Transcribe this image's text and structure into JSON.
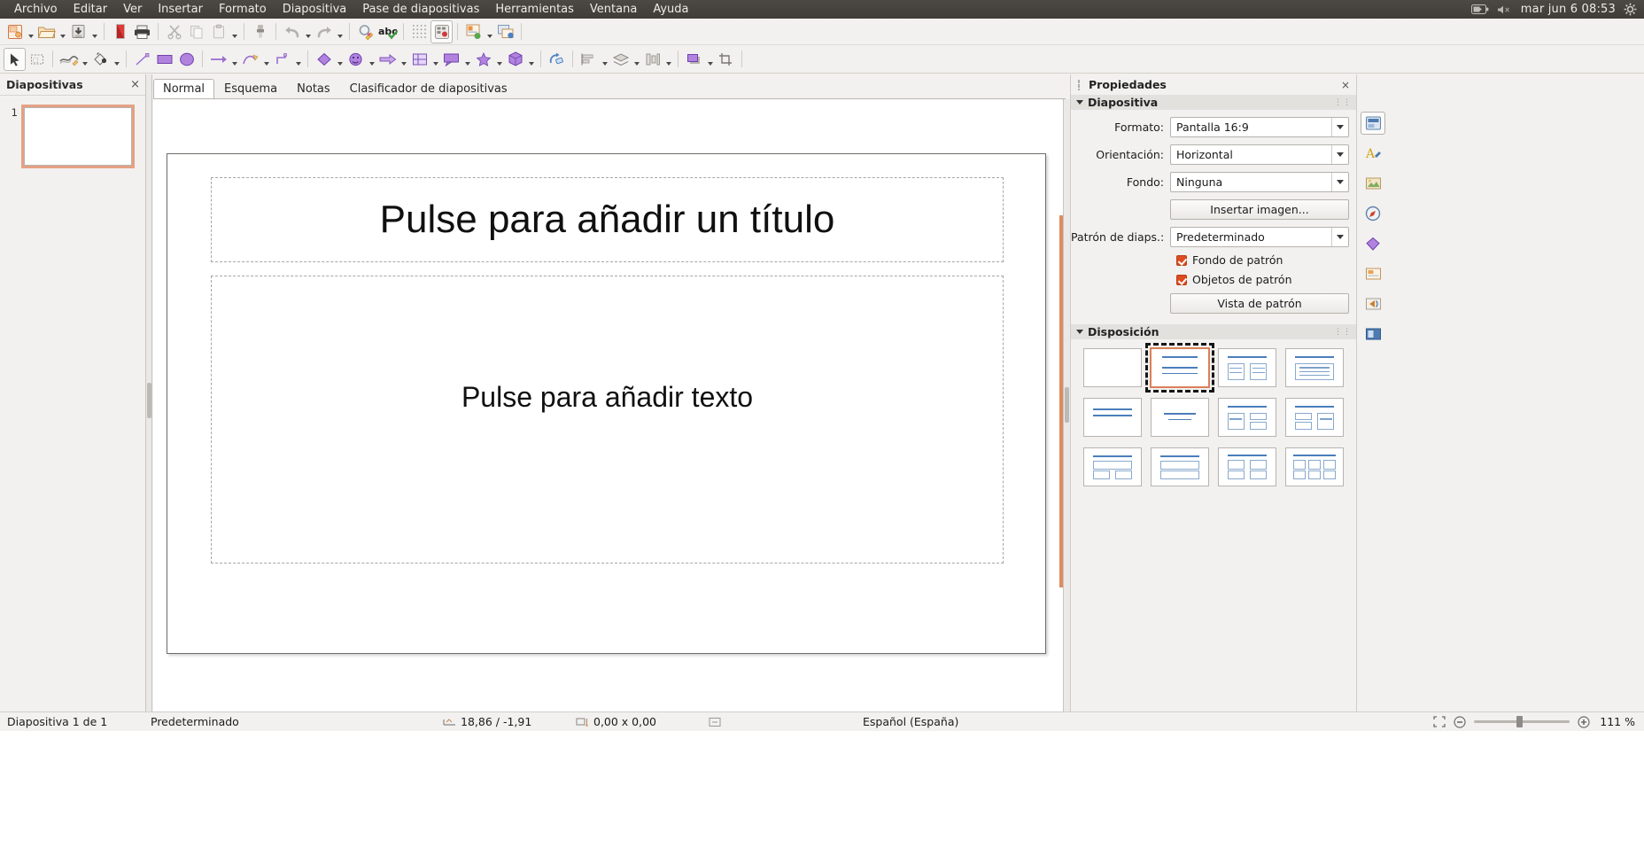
{
  "topbar": {
    "menu": [
      "Archivo",
      "Editar",
      "Ver",
      "Insertar",
      "Formato",
      "Diapositiva",
      "Pase de diapositivas",
      "Herramientas",
      "Ventana",
      "Ayuda"
    ],
    "clock": "mar jun 6   08:53",
    "icons": [
      "battery-icon",
      "volume-muted-icon",
      "system-gear-icon"
    ]
  },
  "toolbar_standard": {
    "items": [
      {
        "name": "new-document-button",
        "icon": "new-presentation-icon",
        "dropdown": true
      },
      {
        "name": "open-document-button",
        "icon": "folder-open-icon",
        "dropdown": true
      },
      {
        "name": "save-document-button",
        "icon": "save-icon",
        "dropdown": true
      },
      {
        "name": "export-pdf-button",
        "icon": "pdf-icon",
        "dropdown": false
      },
      {
        "name": "print-button",
        "icon": "printer-icon",
        "dropdown": false
      },
      {
        "name": "cut-button",
        "icon": "scissors-icon",
        "dropdown": false
      },
      {
        "name": "copy-button",
        "icon": "copy-icon",
        "dropdown": false
      },
      {
        "name": "paste-button",
        "icon": "clipboard-icon",
        "dropdown": true
      },
      {
        "name": "clone-formatting-button",
        "icon": "paintbrush-icon",
        "dropdown": false
      },
      {
        "name": "undo-button",
        "icon": "undo-arrow-icon",
        "dropdown": true
      },
      {
        "name": "redo-button",
        "icon": "redo-arrow-icon",
        "dropdown": true
      },
      {
        "name": "find-replace-button",
        "icon": "magnifier-pencil-icon",
        "dropdown": false
      },
      {
        "name": "spelling-button",
        "icon": "abc-check-icon",
        "dropdown": false
      },
      {
        "name": "display-grid-button",
        "icon": "grid-dots-icon",
        "dropdown": false
      },
      {
        "name": "display-views-button",
        "icon": "slide-grid-icon",
        "dropdown": false
      },
      {
        "name": "start-slideshow-button",
        "icon": "presentation-screen-icon",
        "dropdown": true
      },
      {
        "name": "new-slide-button",
        "icon": "new-slide-icon",
        "dropdown": true
      }
    ]
  },
  "toolbar_drawing": {
    "items": [
      {
        "name": "select-tool",
        "icon": "cursor-arrow-icon",
        "selected": true
      },
      {
        "name": "zoom-tool",
        "icon": "zoom-rect-icon"
      },
      {
        "name": "line-color-tool",
        "icon": "line-style-icon",
        "dropdown": true
      },
      {
        "name": "fill-color-tool",
        "icon": "fill-bucket-icon",
        "dropdown": true
      },
      {
        "name": "insert-line-tool",
        "icon": "line-icon"
      },
      {
        "name": "rectangle-tool",
        "icon": "rectangle-icon"
      },
      {
        "name": "ellipse-tool",
        "icon": "ellipse-icon"
      },
      {
        "name": "lines-arrows-tool",
        "icon": "arrow-line-icon",
        "dropdown": true
      },
      {
        "name": "curves-polygons-tool",
        "icon": "curve-icon",
        "dropdown": true
      },
      {
        "name": "connectors-tool",
        "icon": "connector-icon",
        "dropdown": true
      },
      {
        "name": "basic-shapes-tool",
        "icon": "basic-shapes-icon",
        "dropdown": true
      },
      {
        "name": "symbol-shapes-tool",
        "icon": "smiley-shape-icon",
        "dropdown": true
      },
      {
        "name": "block-arrows-tool",
        "icon": "block-arrow-icon",
        "dropdown": true
      },
      {
        "name": "flowchart-tool",
        "icon": "flowchart-icon",
        "dropdown": true
      },
      {
        "name": "callouts-tool",
        "icon": "callout-icon",
        "dropdown": true
      },
      {
        "name": "stars-tool",
        "icon": "star-shape-icon",
        "dropdown": true
      },
      {
        "name": "3d-objects-tool",
        "icon": "cube-3d-icon",
        "dropdown": true
      },
      {
        "name": "rotate-tool",
        "icon": "rotate-icon"
      },
      {
        "name": "align-objects-tool",
        "icon": "align-icon",
        "dropdown": true
      },
      {
        "name": "arrange-tool",
        "icon": "arrange-stack-icon",
        "dropdown": true
      },
      {
        "name": "distribute-tool",
        "icon": "distribute-columns-icon",
        "dropdown": true
      },
      {
        "name": "shadow-tool",
        "icon": "shadow-icon",
        "dropdown": true
      },
      {
        "name": "crop-tool",
        "icon": "crop-icon"
      },
      {
        "name": "filter-tool",
        "icon": "filter-icon"
      },
      {
        "name": "points-tool",
        "icon": "edit-points-icon"
      },
      {
        "name": "glue-points-tool",
        "icon": "glue-points-icon"
      },
      {
        "name": "insert-textbox-tool",
        "icon": "textbox-icon"
      },
      {
        "name": "insert-image-tool",
        "icon": "image-icon"
      },
      {
        "name": "insert-chart-tool",
        "icon": "chart-icon"
      },
      {
        "name": "insert-table-tool",
        "icon": "table-icon"
      },
      {
        "name": "transformations-tool",
        "icon": "transform-icon"
      },
      {
        "name": "toggle-extrusion-tool",
        "icon": "extrusion-icon"
      },
      {
        "name": "fontwork-tool",
        "icon": "fontwork-icon"
      },
      {
        "name": "highlight-tool",
        "icon": "highlighter-icon"
      },
      {
        "name": "shapes-extra-tool",
        "icon": "shape-extra-icon"
      }
    ]
  },
  "slide_panel": {
    "title": "Diapositivas",
    "close_label": "×",
    "slides": [
      {
        "number": "1",
        "selected": true
      }
    ]
  },
  "view_tabs": [
    {
      "label": "Normal",
      "active": true
    },
    {
      "label": "Esquema",
      "active": false
    },
    {
      "label": "Notas",
      "active": false
    },
    {
      "label": "Clasificador de diapositivas",
      "active": false
    }
  ],
  "slide_canvas": {
    "title_placeholder": "Pulse para añadir un título",
    "body_placeholder": "Pulse para añadir texto"
  },
  "sidebar": {
    "title": "Propiedades",
    "close_label": "×",
    "sections": [
      {
        "name": "Diapositiva",
        "label": "Diapositiva",
        "rows": [
          {
            "label": "Formato:",
            "value": "Pantalla 16:9",
            "type": "combo"
          },
          {
            "label": "Orientación:",
            "value": "Horizontal",
            "type": "combo"
          },
          {
            "label": "Fondo:",
            "value": "Ninguna",
            "type": "combo"
          },
          {
            "label": "",
            "value": "Insertar imagen...",
            "type": "button"
          },
          {
            "label": "Patrón de diaps.:",
            "value": "Predeterminado",
            "type": "combo"
          }
        ],
        "checkboxes": [
          {
            "label": "Fondo de patrón",
            "checked": true
          },
          {
            "label": "Objetos de patrón",
            "checked": true
          }
        ],
        "master_view_button": "Vista de patrón"
      },
      {
        "name": "Disposicion",
        "label": "Disposición",
        "layouts": [
          {
            "id": "blank",
            "selected": false
          },
          {
            "id": "title-content",
            "selected": true
          },
          {
            "id": "title-two-content",
            "selected": false
          },
          {
            "id": "title-only",
            "selected": false
          },
          {
            "id": "centered-text",
            "selected": false
          },
          {
            "id": "title-centered",
            "selected": false
          },
          {
            "id": "two-content-right-split",
            "selected": false
          },
          {
            "id": "two-content-left-split",
            "selected": false
          },
          {
            "id": "content-over-two",
            "selected": false
          },
          {
            "id": "stacked-rows",
            "selected": false
          },
          {
            "id": "four-content",
            "selected": false
          },
          {
            "id": "six-content",
            "selected": false
          }
        ]
      }
    ],
    "rail_tabs": [
      {
        "name": "properties",
        "icon": "properties-panel-icon",
        "active": true
      },
      {
        "name": "styles",
        "icon": "character-styles-icon",
        "active": false
      },
      {
        "name": "gallery",
        "icon": "gallery-icon",
        "active": false
      },
      {
        "name": "navigator",
        "icon": "navigator-compass-icon",
        "active": false
      },
      {
        "name": "shapes",
        "icon": "shapes-panel-icon",
        "active": false
      },
      {
        "name": "master-slides",
        "icon": "master-slides-icon",
        "active": false
      },
      {
        "name": "animation",
        "icon": "animation-icon",
        "active": false
      },
      {
        "name": "slide-transition",
        "icon": "slide-transition-icon",
        "active": false
      }
    ]
  },
  "statusbar": {
    "slide_count": "Diapositiva 1 de 1",
    "master": "Predeterminado",
    "position": "18,86 / -1,91",
    "size": "0,00 x 0,00",
    "language": "Español (España)",
    "zoom_percent": "111 %",
    "zoom_out_label": "−",
    "zoom_in_label": "+",
    "icons": [
      "cursor-position-icon",
      "object-size-icon",
      "edit-mode-icon",
      "fit-slide-icon"
    ]
  }
}
